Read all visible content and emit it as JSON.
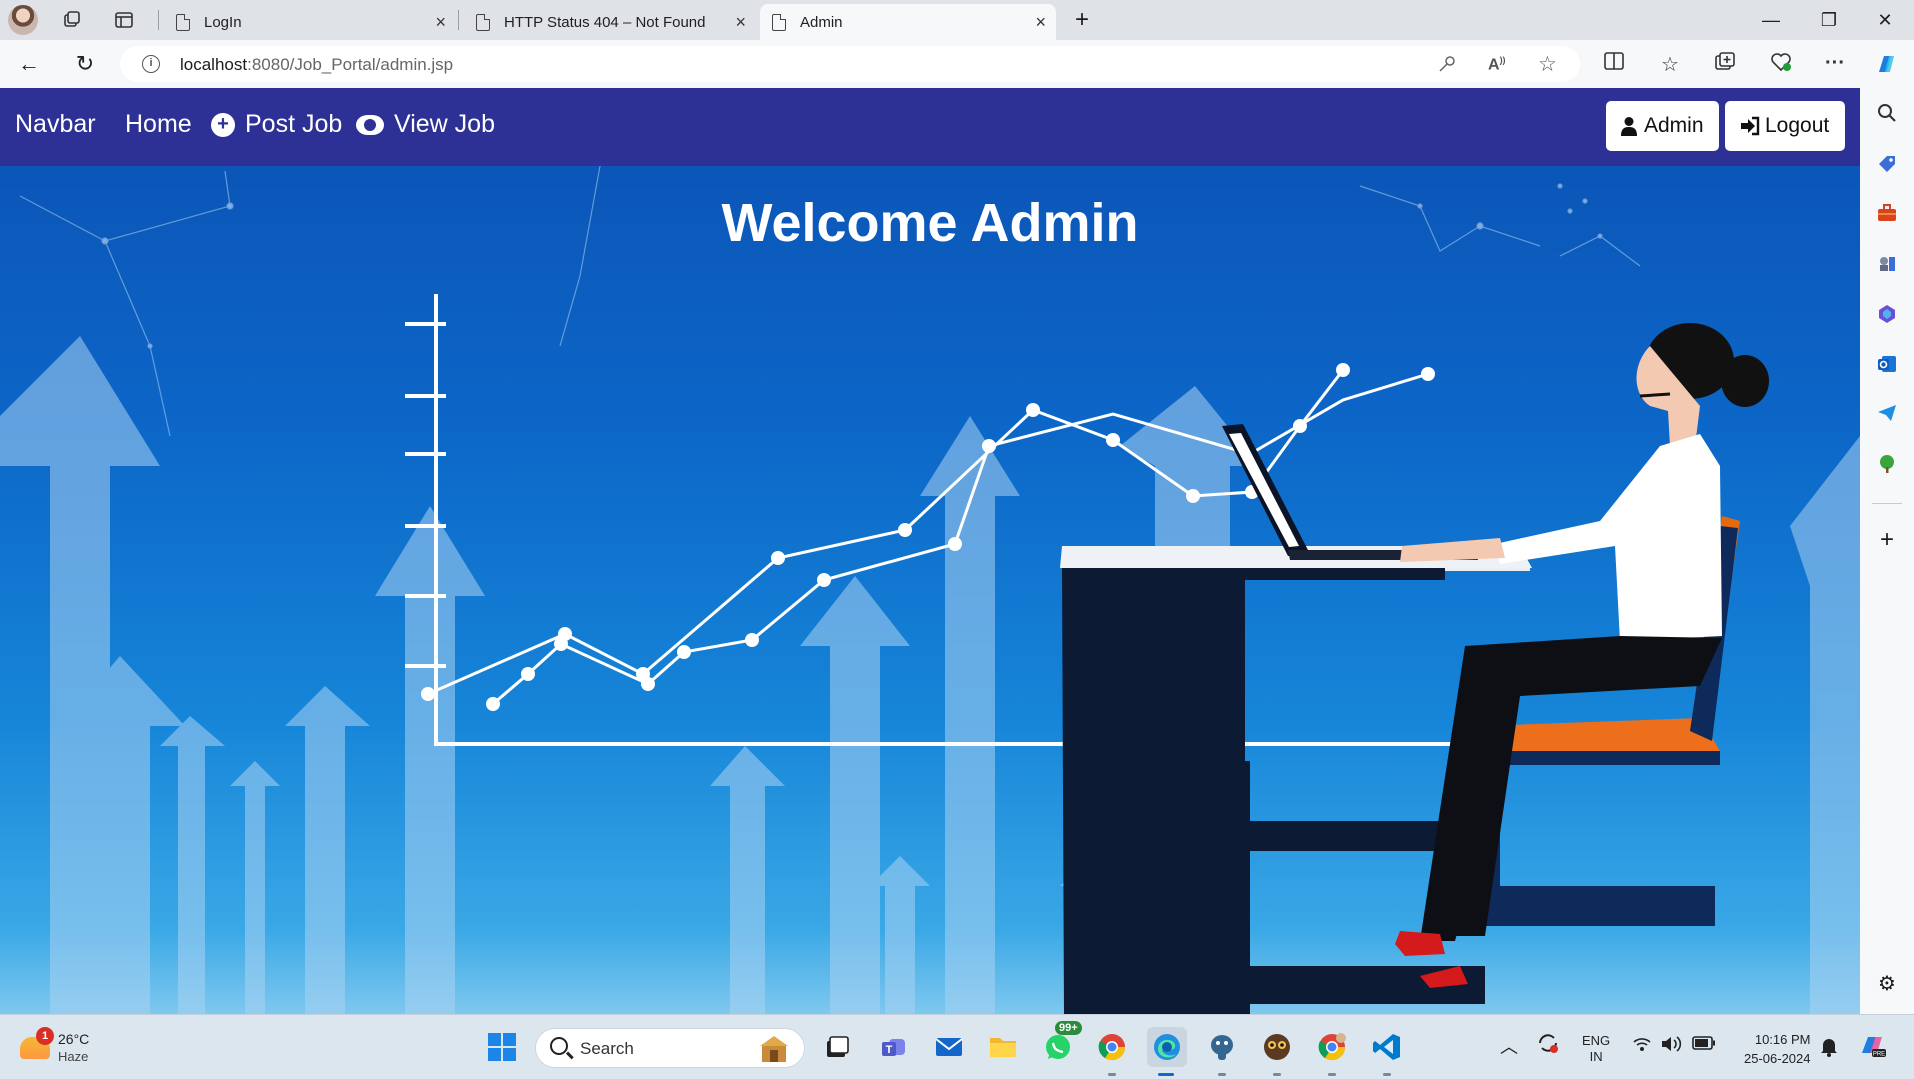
{
  "browser": {
    "tabs": [
      {
        "title": "LogIn",
        "active": false
      },
      {
        "title": "HTTP Status 404 – Not Found",
        "active": false
      },
      {
        "title": "Admin",
        "active": true
      }
    ],
    "new_tab_glyph": "+",
    "close_glyph": "×",
    "window_controls": {
      "minimize": "—",
      "restore": "❐",
      "close": "✕"
    },
    "url_host": "localhost",
    "url_path": ":8080/Job_Portal/admin.jsp",
    "back_glyph": "←",
    "reload_glyph": "↻"
  },
  "navbar": {
    "brand": "Navbar",
    "links": [
      {
        "label": "Home",
        "icon": ""
      },
      {
        "label": "Post Job",
        "icon": "plus-circle-icon"
      },
      {
        "label": "View Job",
        "icon": "eye-icon"
      }
    ],
    "admin_button": "Admin",
    "logout_button": "Logout",
    "bg_color": "#2d3196"
  },
  "hero": {
    "heading": "Welcome Admin"
  },
  "taskbar": {
    "weather": {
      "temp": "26°C",
      "condition": "Haze",
      "badge": "1"
    },
    "search_placeholder": "Search",
    "whatsapp_badge": "99+",
    "language": {
      "line1": "ENG",
      "line2": "IN"
    },
    "clock": {
      "time": "10:16 PM",
      "date": "25-06-2024"
    }
  }
}
